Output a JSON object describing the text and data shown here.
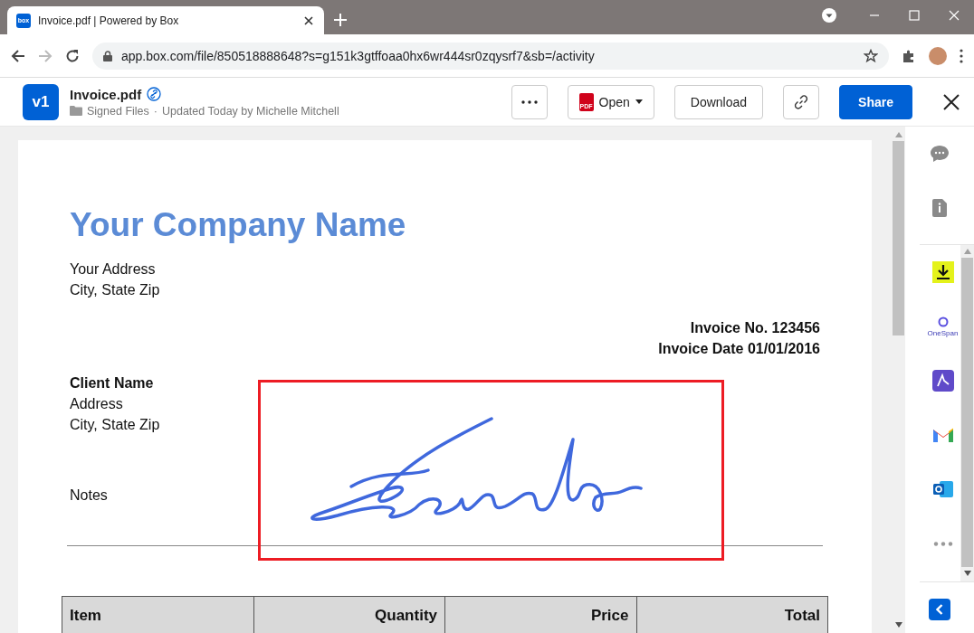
{
  "browser": {
    "tab": {
      "favicon": "box",
      "title": "Invoice.pdf | Powered by Box"
    },
    "url": "app.box.com/file/850518888648?s=g151k3gtffoaa0hx6wr444sr0zqysrf7&sb=/activity"
  },
  "header": {
    "version": "v1",
    "file_name": "Invoice.pdf",
    "folder": "Signed Files",
    "separator": "·",
    "updated": "Updated Today by Michelle Mitchell",
    "open": {
      "badge": "PDF",
      "label": "Open"
    },
    "download": "Download",
    "share": "Share"
  },
  "document": {
    "company": "Your Company Name",
    "address": [
      "Your Address",
      "City, State Zip"
    ],
    "invoice": [
      "Invoice No. 123456",
      "Invoice Date 01/01/2016"
    ],
    "client_name": "Client Name",
    "client": [
      "Address",
      "City, State Zip"
    ],
    "notes": "Notes",
    "table": {
      "columns": [
        "Item",
        "Quantity",
        "Price",
        "Total"
      ]
    }
  },
  "sidebar": {
    "panels": [
      {
        "kind": "activity"
      },
      {
        "kind": "details"
      }
    ],
    "apps": [
      {
        "kind": "download"
      },
      {
        "kind": "onespan",
        "label": "OneSpan"
      },
      {
        "kind": "acrobat"
      },
      {
        "kind": "gmail"
      },
      {
        "kind": "outlook"
      },
      {
        "kind": "more"
      }
    ]
  }
}
